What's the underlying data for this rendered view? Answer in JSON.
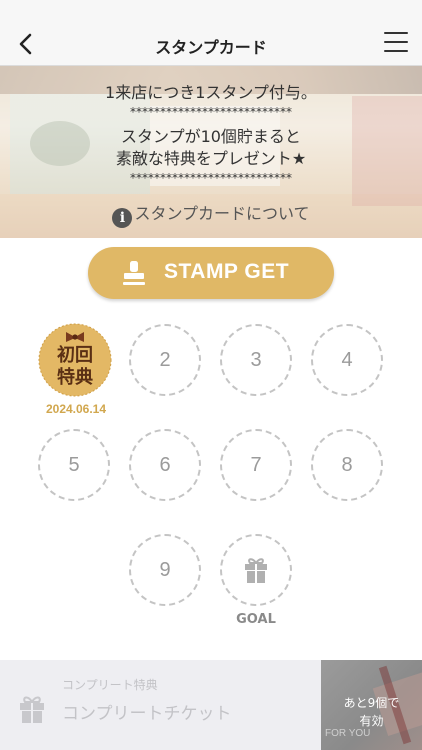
{
  "header": {
    "title": "スタンプカード"
  },
  "hero": {
    "line1": "1来店につき1スタンプ付与。",
    "stars": "***************************",
    "line2": "スタンプが10個貯まると",
    "line3": "素敵な特典をプレゼント★",
    "about_icon": "i",
    "about_label": "スタンプカードについて"
  },
  "stamp_button": {
    "label": "STAMP GET",
    "icon": "stamp-icon"
  },
  "stamps": {
    "first": {
      "line1": "初回",
      "line2": "特典",
      "date": "2024.06.14"
    },
    "slots": [
      "2",
      "3",
      "4",
      "5",
      "6",
      "7",
      "8",
      "9"
    ],
    "goal_label": "GOAL",
    "goal_icon": "gift-icon"
  },
  "complete_reward": {
    "caption": "コンプリート特典",
    "title": "コンプリートチケット",
    "remain_line1": "あと9個で",
    "remain_line2": "有効",
    "image_text": "FOR YOU"
  },
  "colors": {
    "accent": "#e0b866",
    "badge": "#d1a74e",
    "dashed": "#c4c4c4"
  }
}
